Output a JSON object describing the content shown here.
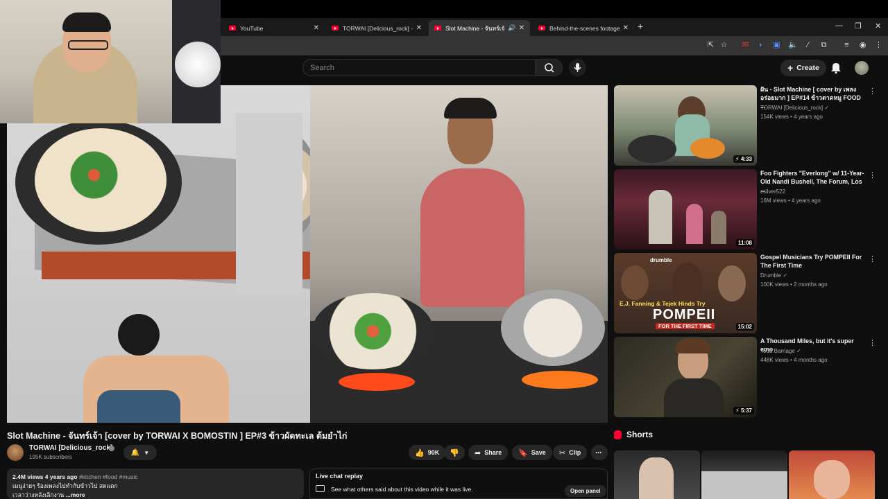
{
  "browser": {
    "tabs": [
      {
        "title": "YouTube",
        "active": false
      },
      {
        "title": "TORWAI [Delicious_rock] - YouT",
        "active": false
      },
      {
        "title": "Slot Machine - จันทร์เจ้า [cov",
        "active": true,
        "audio": true
      },
      {
        "title": "Behind-the-scenes footage of t",
        "active": false
      }
    ],
    "new_tab": "+",
    "close": "✕"
  },
  "youtube_header": {
    "search_placeholder": "Search",
    "create_label": "Create"
  },
  "video": {
    "title": "Slot Machine - จันทร์เจ้า [cover by TORWAI X BOMOSTIN ] EP#3 ข้าวผัดทะเล ต้มยำไก่",
    "channel": "TORWAI [Delicious_rock]",
    "subscribers": "195K subscribers",
    "likes": "90K",
    "share_label": "Share",
    "save_label": "Save",
    "clip_label": "Clip",
    "more": "⋯"
  },
  "description": {
    "stats": "2.4M views  4 years ago",
    "tags": "#kitchen #food #music",
    "line2": "เมนูง่ายๆ ร้องเพลงไปทำกับข้าวไป สดแตก",
    "line3": "เวลาว่างหลังเลิกงาน",
    "more": "...more"
  },
  "live_chat": {
    "header": "Live chat replay",
    "subtitle": "See what others said about this video while it was live.",
    "open_panel": "Open panel"
  },
  "recommendations": [
    {
      "title": "ฝัน  - Slot Machine [ cover by เพลง อร่อยมาก ] EP#14 ข้าวตาดหมู FOOD ...",
      "channel": "TORWAI [Delicious_rock]",
      "verified": true,
      "views": "154K views • 4 years ago",
      "duration": "4:33",
      "shorts_badge": true
    },
    {
      "title": "Foo Fighters \"Everlong\" w/ 11-Year-Old Nandi Bushell, The Forum, Los ...",
      "channel": "csilver522",
      "verified": false,
      "views": "16M views • 4 years ago",
      "duration": "11:08",
      "shorts_badge": false
    },
    {
      "title": "Gospel Musicians Try POMPEII For The First Time",
      "channel": "Drumble",
      "verified": true,
      "views": "100K views • 2 months ago",
      "duration": "15:02",
      "shorts_badge": false,
      "thumb_text": "POMPEII",
      "thumb_sub": "FOR THE FIRST TIME",
      "thumb_top": "E.J. Fanning & Tejek Hinds Try",
      "thumb_brand": "drumble"
    },
    {
      "title": "A Thousand Miles, but it's super emo",
      "channel": "Todd Barriage",
      "verified": true,
      "views": "448K views • 4 months ago",
      "duration": "5:37",
      "shorts_badge": true
    }
  ],
  "shorts": {
    "header": "Shorts"
  },
  "colors": {
    "bg": "#0f0f0f",
    "pill": "#272727",
    "accent_red": "#ff0033"
  }
}
